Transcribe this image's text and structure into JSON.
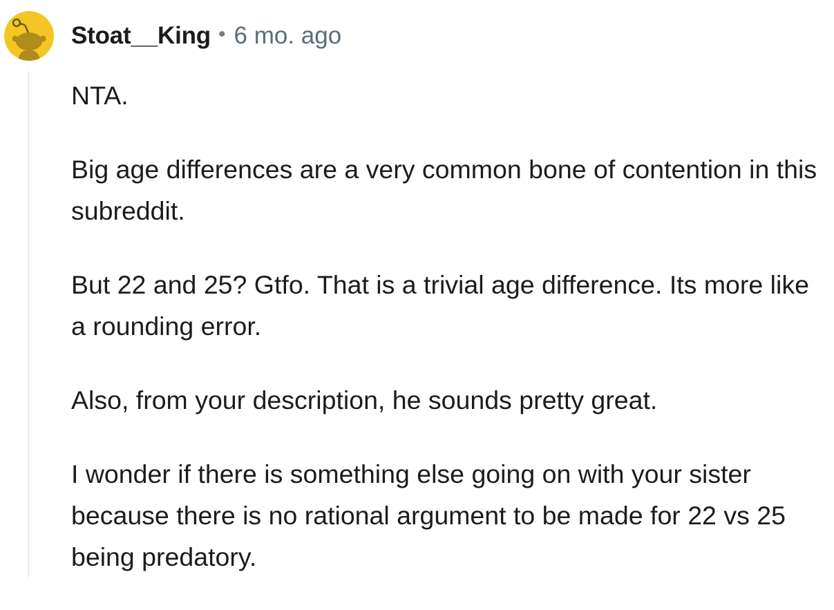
{
  "comment": {
    "author": "Stoat__King",
    "separator": "•",
    "timestamp": "6 mo. ago",
    "avatar_icon": "reddit-snoo-avatar-icon",
    "avatar_bg": "#f3c623",
    "paragraphs": [
      "NTA.",
      "Big age differences are a very common bone of contention in this subreddit.",
      "But 22 and 25? Gtfo. That is a trivial age difference. Its more like a rounding error.",
      "Also, from your description, he sounds pretty great.",
      "I wonder if there is something else going on with your sister because there is no rational argument to be made for 22 vs 25 being predatory."
    ]
  }
}
